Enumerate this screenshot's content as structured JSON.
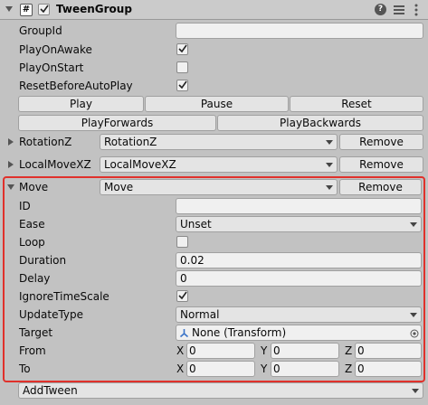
{
  "header": {
    "title": "TweenGroup",
    "script_icon": "#",
    "enabled": true
  },
  "top_fields": {
    "group_id": {
      "label": "GroupId",
      "value": ""
    },
    "play_on_awake": {
      "label": "PlayOnAwake",
      "checked": true
    },
    "play_on_start": {
      "label": "PlayOnStart",
      "checked": false
    },
    "reset_before_auto_play": {
      "label": "ResetBeforeAutoPlay",
      "checked": true
    }
  },
  "controls": {
    "play": "Play",
    "pause": "Pause",
    "reset": "Reset",
    "play_forwards": "PlayForwards",
    "play_backwards": "PlayBackwards"
  },
  "tweens": [
    {
      "label": "RotationZ",
      "type": "RotationZ",
      "remove": "Remove"
    },
    {
      "label": "LocalMoveXZ",
      "type": "LocalMoveXZ",
      "remove": "Remove"
    }
  ],
  "move": {
    "label": "Move",
    "type": "Move",
    "remove": "Remove",
    "id": {
      "label": "ID",
      "value": ""
    },
    "ease": {
      "label": "Ease",
      "value": "Unset"
    },
    "loop": {
      "label": "Loop",
      "checked": false
    },
    "duration": {
      "label": "Duration",
      "value": "0.02"
    },
    "delay": {
      "label": "Delay",
      "value": "0"
    },
    "ignore_time_scale": {
      "label": "IgnoreTimeScale",
      "checked": true
    },
    "update_type": {
      "label": "UpdateType",
      "value": "Normal"
    },
    "target": {
      "label": "Target",
      "value": "None (Transform)"
    },
    "from": {
      "label": "From",
      "x_label": "X",
      "x": "0",
      "y_label": "Y",
      "y": "0",
      "z_label": "Z",
      "z": "0"
    },
    "to": {
      "label": "To",
      "x_label": "X",
      "x": "0",
      "y_label": "Y",
      "y": "0",
      "z_label": "Z",
      "z": "0"
    }
  },
  "add_tween": "AddTween"
}
